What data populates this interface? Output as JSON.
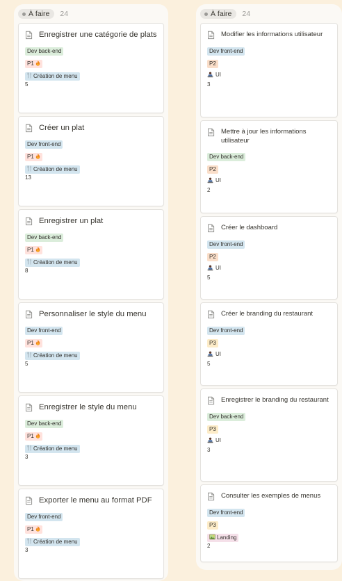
{
  "columns": [
    {
      "status": "À faire",
      "count": "24",
      "cards": [
        {
          "title": "Enregistrer une catégorie de plats",
          "type": "Dev back-end",
          "priority": "P1",
          "epic": "Création de menu",
          "estimate": "5"
        },
        {
          "title": "Créer un plat",
          "type": "Dev front-end",
          "priority": "P1",
          "epic": "Création de menu",
          "estimate": "13"
        },
        {
          "title": "Enregistrer un plat",
          "type": "Dev back-end",
          "priority": "P1",
          "epic": "Création de menu",
          "estimate": "8"
        },
        {
          "title": "Personnaliser le style du menu",
          "type": "Dev front-end",
          "priority": "P1",
          "epic": "Création de menu",
          "estimate": "5"
        },
        {
          "title": "Enregistrer le style du menu",
          "type": "Dev back-end",
          "priority": "P1",
          "epic": "Création de menu",
          "estimate": "3"
        },
        {
          "title": "Exporter le menu au format PDF",
          "type": "Dev front-end",
          "priority": "P1",
          "epic": "Création de menu",
          "estimate": "3"
        }
      ]
    },
    {
      "status": "À faire",
      "count": "24",
      "cards": [
        {
          "title": "Modifier les informations utilisateur",
          "type": "Dev front-end",
          "priority": "P2",
          "epic": "UI",
          "estimate": "3"
        },
        {
          "title": "Mettre à jour les informations utilisateur",
          "type": "Dev back-end",
          "priority": "P2",
          "epic": "UI",
          "estimate": "2"
        },
        {
          "title": "Créer le dashboard",
          "type": "Dev front-end",
          "priority": "P2",
          "epic": "UI",
          "estimate": "5"
        },
        {
          "title": "Créer le branding du restaurant",
          "type": "Dev front-end",
          "priority": "P3",
          "epic": "UI",
          "estimate": "5"
        },
        {
          "title": "Enregistrer le branding du restaurant",
          "type": "Dev back-end",
          "priority": "P3",
          "epic": "UI",
          "estimate": "3"
        },
        {
          "title": "Consulter les exemples de menus",
          "type": "Dev front-end",
          "priority": "P3",
          "epic": "Landing",
          "estimate": "2"
        }
      ]
    }
  ],
  "colors": {
    "background": "#fbf0dd",
    "column": "#fbf9f5",
    "dev_back_end": "#dbeddb",
    "dev_front_end": "#d3e5ef",
    "p1": "#ffe2dd",
    "p2": "#fadec9",
    "p3": "#fdecc8",
    "landing": "#f5e0e9"
  },
  "icons": {
    "card": "document-icon",
    "p1": "fire-icon",
    "menu_epic": "fork-knife-icon",
    "ui_epic": "designer-icon",
    "landing_epic": "picture-icon"
  }
}
